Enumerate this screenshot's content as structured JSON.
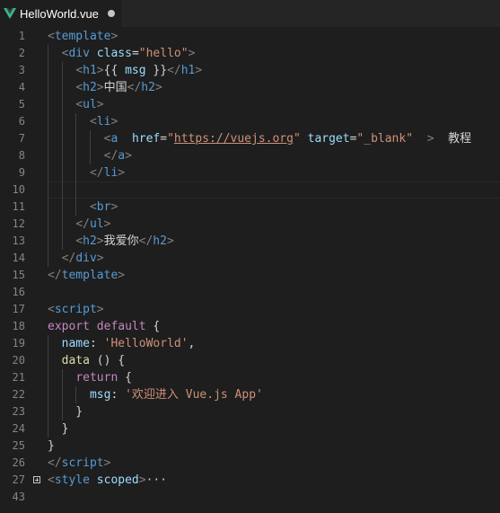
{
  "tab": {
    "title": "HelloWorld.vue",
    "icon": "vue-logo-icon",
    "dirty": true
  },
  "editor": {
    "lines": [
      {
        "number": "1",
        "tokens": [
          {
            "t": "<",
            "c": "t-brk"
          },
          {
            "t": "template",
            "c": "t-tag"
          },
          {
            "t": ">",
            "c": "t-brk"
          }
        ]
      },
      {
        "number": "2",
        "tokens": [
          {
            "t": "  ",
            "c": "t-text"
          },
          {
            "t": "<",
            "c": "t-brk"
          },
          {
            "t": "div",
            "c": "t-tag"
          },
          {
            "t": " ",
            "c": "t-text"
          },
          {
            "t": "class",
            "c": "t-attr"
          },
          {
            "t": "=",
            "c": "t-text"
          },
          {
            "t": "\"hello\"",
            "c": "t-str"
          },
          {
            "t": ">",
            "c": "t-brk"
          }
        ]
      },
      {
        "number": "3",
        "tokens": [
          {
            "t": "    ",
            "c": "t-text"
          },
          {
            "t": "<",
            "c": "t-brk"
          },
          {
            "t": "h1",
            "c": "t-tag"
          },
          {
            "t": ">",
            "c": "t-brk"
          },
          {
            "t": "{{ ",
            "c": "t-text"
          },
          {
            "t": "msg",
            "c": "t-prop"
          },
          {
            "t": " }}",
            "c": "t-text"
          },
          {
            "t": "</",
            "c": "t-brk"
          },
          {
            "t": "h1",
            "c": "t-tag"
          },
          {
            "t": ">",
            "c": "t-brk"
          }
        ]
      },
      {
        "number": "4",
        "tokens": [
          {
            "t": "    ",
            "c": "t-text"
          },
          {
            "t": "<",
            "c": "t-brk"
          },
          {
            "t": "h2",
            "c": "t-tag"
          },
          {
            "t": ">",
            "c": "t-brk"
          },
          {
            "t": "中国",
            "c": "t-text"
          },
          {
            "t": "</",
            "c": "t-brk"
          },
          {
            "t": "h2",
            "c": "t-tag"
          },
          {
            "t": ">",
            "c": "t-brk"
          }
        ]
      },
      {
        "number": "5",
        "tokens": [
          {
            "t": "    ",
            "c": "t-text"
          },
          {
            "t": "<",
            "c": "t-brk"
          },
          {
            "t": "ul",
            "c": "t-tag"
          },
          {
            "t": ">",
            "c": "t-brk"
          }
        ]
      },
      {
        "number": "6",
        "tokens": [
          {
            "t": "      ",
            "c": "t-text"
          },
          {
            "t": "<",
            "c": "t-brk"
          },
          {
            "t": "li",
            "c": "t-tag"
          },
          {
            "t": ">",
            "c": "t-brk"
          }
        ]
      },
      {
        "number": "7",
        "tokens": [
          {
            "t": "        ",
            "c": "t-text"
          },
          {
            "t": "<",
            "c": "t-brk"
          },
          {
            "t": "a",
            "c": "t-tag"
          },
          {
            "t": "  ",
            "c": "t-text"
          },
          {
            "t": "href",
            "c": "t-attr"
          },
          {
            "t": "=",
            "c": "t-text"
          },
          {
            "t": "\"",
            "c": "t-str"
          },
          {
            "t": "https://vuejs.org",
            "c": "t-link"
          },
          {
            "t": "\"",
            "c": "t-str"
          },
          {
            "t": " ",
            "c": "t-text"
          },
          {
            "t": "target",
            "c": "t-attr"
          },
          {
            "t": "=",
            "c": "t-text"
          },
          {
            "t": "\"_blank\"",
            "c": "t-str"
          },
          {
            "t": "  ",
            "c": "t-text"
          },
          {
            "t": ">",
            "c": "t-brk"
          },
          {
            "t": "  教程",
            "c": "t-text"
          }
        ]
      },
      {
        "number": "8",
        "tokens": [
          {
            "t": "        ",
            "c": "t-text"
          },
          {
            "t": "</",
            "c": "t-brk"
          },
          {
            "t": "a",
            "c": "t-tag"
          },
          {
            "t": ">",
            "c": "t-brk"
          }
        ]
      },
      {
        "number": "9",
        "tokens": [
          {
            "t": "      ",
            "c": "t-text"
          },
          {
            "t": "</",
            "c": "t-brk"
          },
          {
            "t": "li",
            "c": "t-tag"
          },
          {
            "t": ">",
            "c": "t-brk"
          }
        ]
      },
      {
        "number": "10",
        "tokens": [],
        "current": true
      },
      {
        "number": "11",
        "tokens": [
          {
            "t": "      ",
            "c": "t-text"
          },
          {
            "t": "<",
            "c": "t-brk"
          },
          {
            "t": "br",
            "c": "t-tag"
          },
          {
            "t": ">",
            "c": "t-brk"
          }
        ]
      },
      {
        "number": "12",
        "tokens": [
          {
            "t": "    ",
            "c": "t-text"
          },
          {
            "t": "</",
            "c": "t-brk"
          },
          {
            "t": "ul",
            "c": "t-tag"
          },
          {
            "t": ">",
            "c": "t-brk"
          }
        ]
      },
      {
        "number": "13",
        "tokens": [
          {
            "t": "    ",
            "c": "t-text"
          },
          {
            "t": "<",
            "c": "t-brk"
          },
          {
            "t": "h2",
            "c": "t-tag"
          },
          {
            "t": ">",
            "c": "t-brk"
          },
          {
            "t": "我爱你",
            "c": "t-text"
          },
          {
            "t": "</",
            "c": "t-brk"
          },
          {
            "t": "h2",
            "c": "t-tag"
          },
          {
            "t": ">",
            "c": "t-brk"
          }
        ]
      },
      {
        "number": "14",
        "tokens": [
          {
            "t": "  ",
            "c": "t-text"
          },
          {
            "t": "</",
            "c": "t-brk"
          },
          {
            "t": "div",
            "c": "t-tag"
          },
          {
            "t": ">",
            "c": "t-brk"
          }
        ]
      },
      {
        "number": "15",
        "tokens": [
          {
            "t": "</",
            "c": "t-brk"
          },
          {
            "t": "template",
            "c": "t-tag"
          },
          {
            "t": ">",
            "c": "t-brk"
          }
        ]
      },
      {
        "number": "16",
        "tokens": []
      },
      {
        "number": "17",
        "tokens": [
          {
            "t": "<",
            "c": "t-brk"
          },
          {
            "t": "script",
            "c": "t-tag"
          },
          {
            "t": ">",
            "c": "t-brk"
          }
        ]
      },
      {
        "number": "18",
        "tokens": [
          {
            "t": "export",
            "c": "t-kw"
          },
          {
            "t": " ",
            "c": "t-text"
          },
          {
            "t": "default",
            "c": "t-kw"
          },
          {
            "t": " {",
            "c": "t-text"
          }
        ]
      },
      {
        "number": "19",
        "tokens": [
          {
            "t": "  ",
            "c": "t-text"
          },
          {
            "t": "name",
            "c": "t-prop"
          },
          {
            "t": ": ",
            "c": "t-text"
          },
          {
            "t": "'HelloWorld'",
            "c": "t-str"
          },
          {
            "t": ",",
            "c": "t-text"
          }
        ]
      },
      {
        "number": "20",
        "tokens": [
          {
            "t": "  ",
            "c": "t-text"
          },
          {
            "t": "data",
            "c": "t-fn"
          },
          {
            "t": " () {",
            "c": "t-text"
          }
        ]
      },
      {
        "number": "21",
        "tokens": [
          {
            "t": "    ",
            "c": "t-text"
          },
          {
            "t": "return",
            "c": "t-kw"
          },
          {
            "t": " {",
            "c": "t-text"
          }
        ]
      },
      {
        "number": "22",
        "tokens": [
          {
            "t": "      ",
            "c": "t-text"
          },
          {
            "t": "msg",
            "c": "t-prop"
          },
          {
            "t": ": ",
            "c": "t-text"
          },
          {
            "t": "'欢迎进入 Vue.js App'",
            "c": "t-str"
          }
        ]
      },
      {
        "number": "23",
        "tokens": [
          {
            "t": "    }",
            "c": "t-text"
          }
        ]
      },
      {
        "number": "24",
        "tokens": [
          {
            "t": "  }",
            "c": "t-text"
          }
        ]
      },
      {
        "number": "25",
        "tokens": [
          {
            "t": "}",
            "c": "t-text"
          }
        ]
      },
      {
        "number": "26",
        "tokens": [
          {
            "t": "</",
            "c": "t-brk"
          },
          {
            "t": "script",
            "c": "t-tag"
          },
          {
            "t": ">",
            "c": "t-brk"
          }
        ]
      },
      {
        "number": "27",
        "tokens": [
          {
            "t": "<",
            "c": "t-brk"
          },
          {
            "t": "style",
            "c": "t-tag"
          },
          {
            "t": " ",
            "c": "t-text"
          },
          {
            "t": "scoped",
            "c": "t-attr"
          },
          {
            "t": ">",
            "c": "t-brk"
          },
          {
            "t": "···",
            "c": "t-ell"
          }
        ],
        "folded": true
      },
      {
        "number": "43",
        "tokens": []
      }
    ]
  },
  "colors": {
    "background": "#1e1e1e",
    "tag": "#569cd6",
    "attribute": "#9cdcfe",
    "string": "#ce9178",
    "keyword": "#c586c0",
    "vue_green": "#41b883"
  }
}
